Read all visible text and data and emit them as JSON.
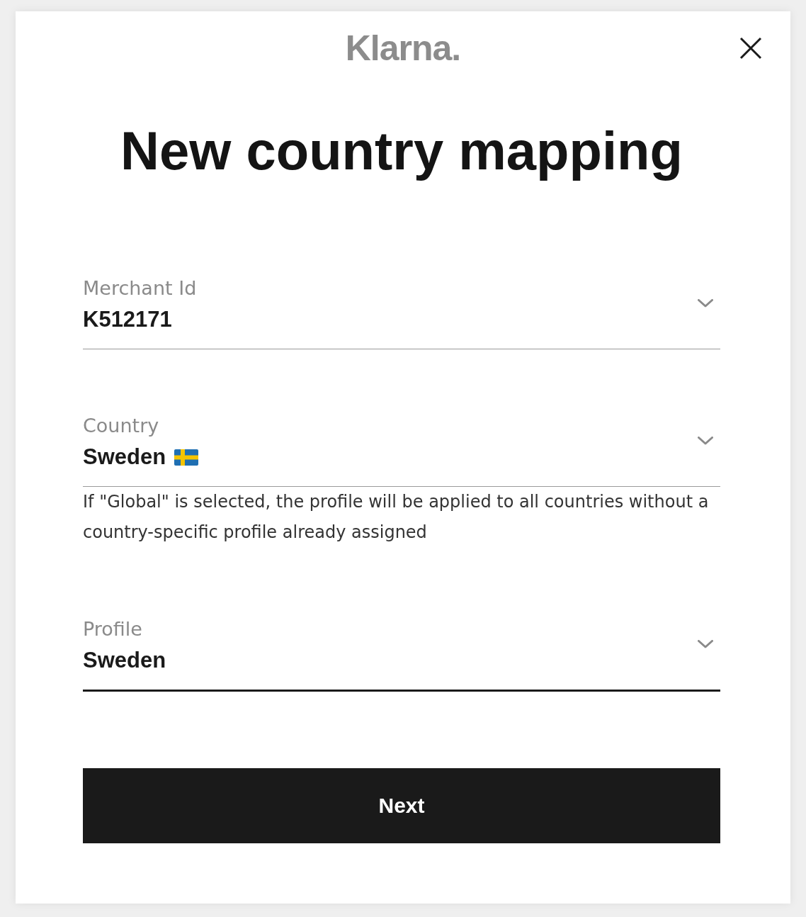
{
  "logo": "Klarna.",
  "title": "New country mapping",
  "fields": [
    {
      "label": "Merchant Id",
      "value": "K512171",
      "flag": false,
      "focused": false
    },
    {
      "label": "Country",
      "value": "Sweden",
      "flag": true,
      "focused": false,
      "hint": "If \"Global\" is selected, the profile will be applied to all countries without a country-specific profile already assigned"
    },
    {
      "label": "Profile",
      "value": "Sweden",
      "flag": false,
      "focused": true
    }
  ],
  "buttons": [
    {
      "label": "Next"
    }
  ]
}
